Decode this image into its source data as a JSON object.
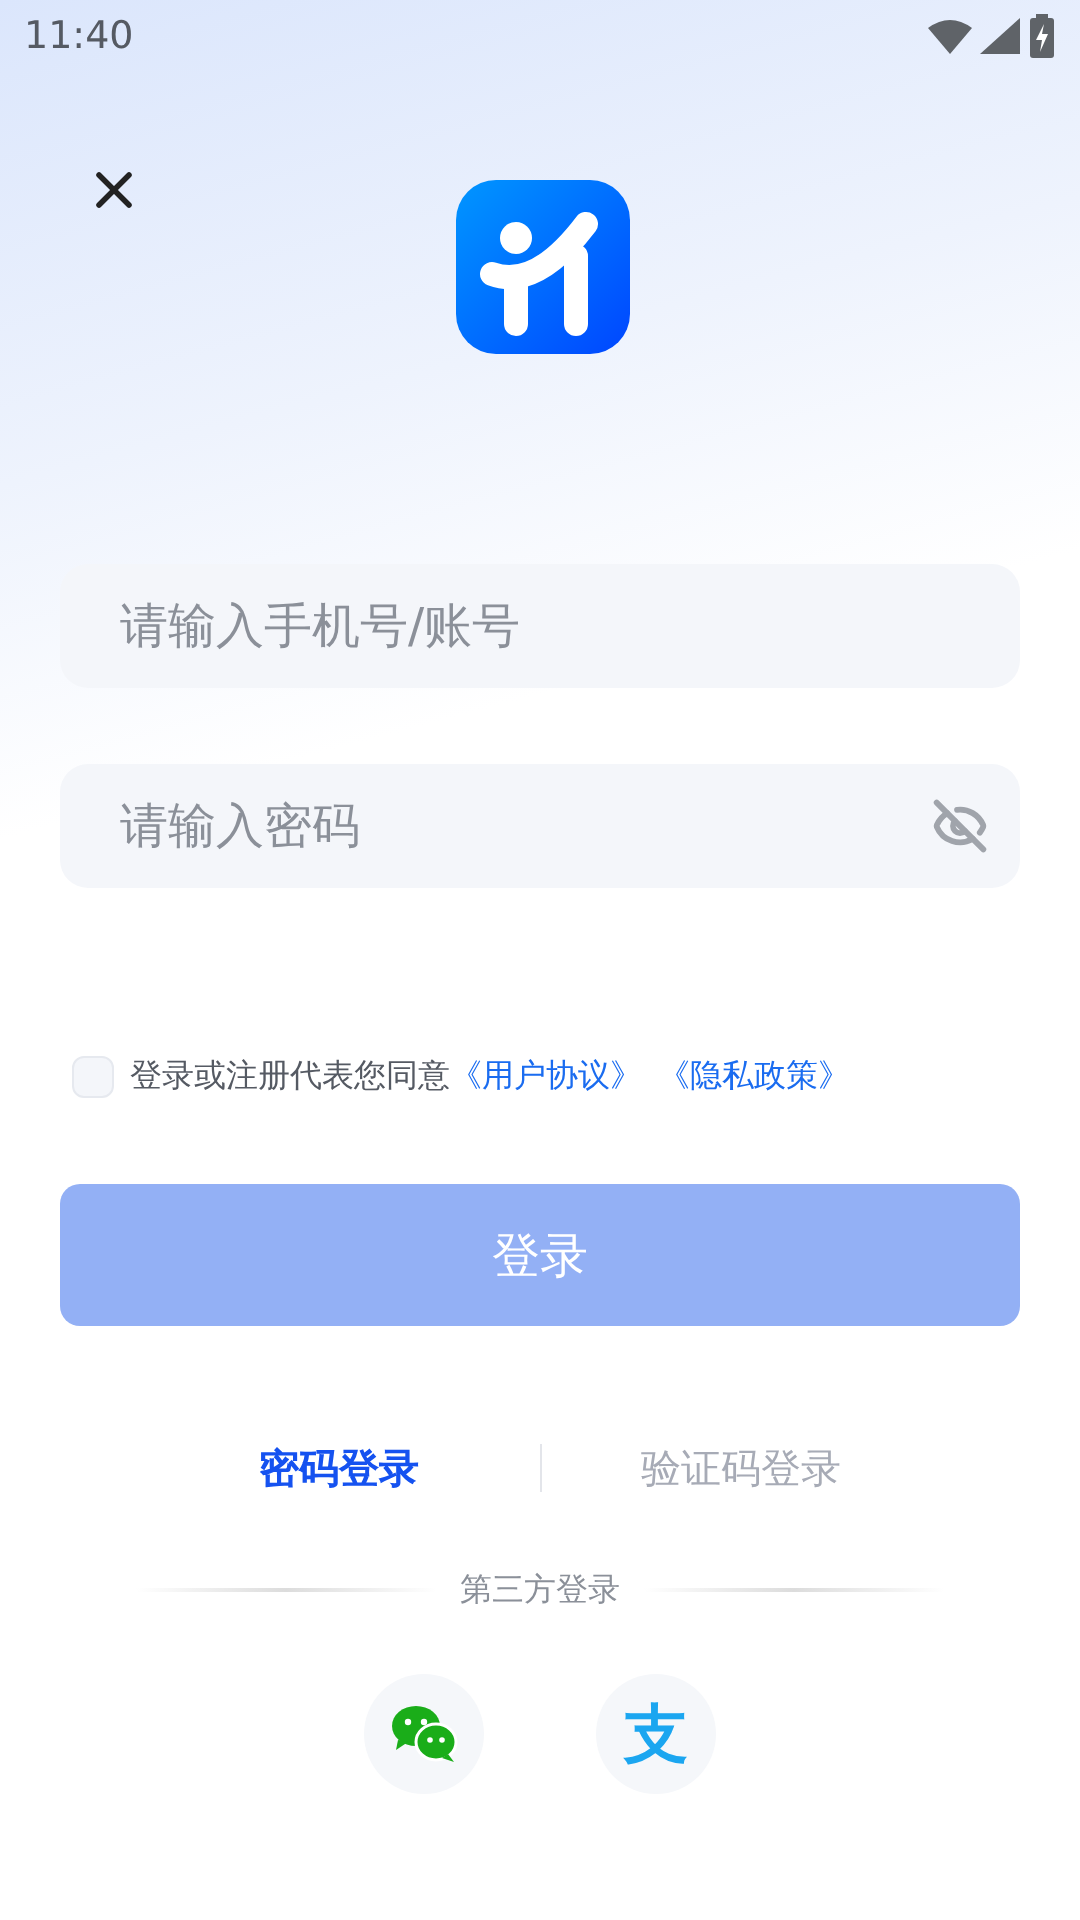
{
  "status_bar": {
    "time": "11:40"
  },
  "account_field": {
    "placeholder": "请输入手机号/账号"
  },
  "password_field": {
    "placeholder": "请输入密码",
    "visible": false
  },
  "agreement": {
    "checked": false,
    "text": "登录或注册代表您同意",
    "links": [
      "《用户协议》",
      "《隐私政策》"
    ]
  },
  "login_button": {
    "label": "登录",
    "disabled": true
  },
  "tabs": [
    {
      "label": "密码登录",
      "selected": true
    },
    {
      "label": "验证码登录",
      "selected": false
    }
  ],
  "third_party": {
    "label": "第三方登录",
    "providers": [
      {
        "kind": "wechat"
      },
      {
        "kind": "alipay",
        "glyph": "支"
      }
    ]
  }
}
